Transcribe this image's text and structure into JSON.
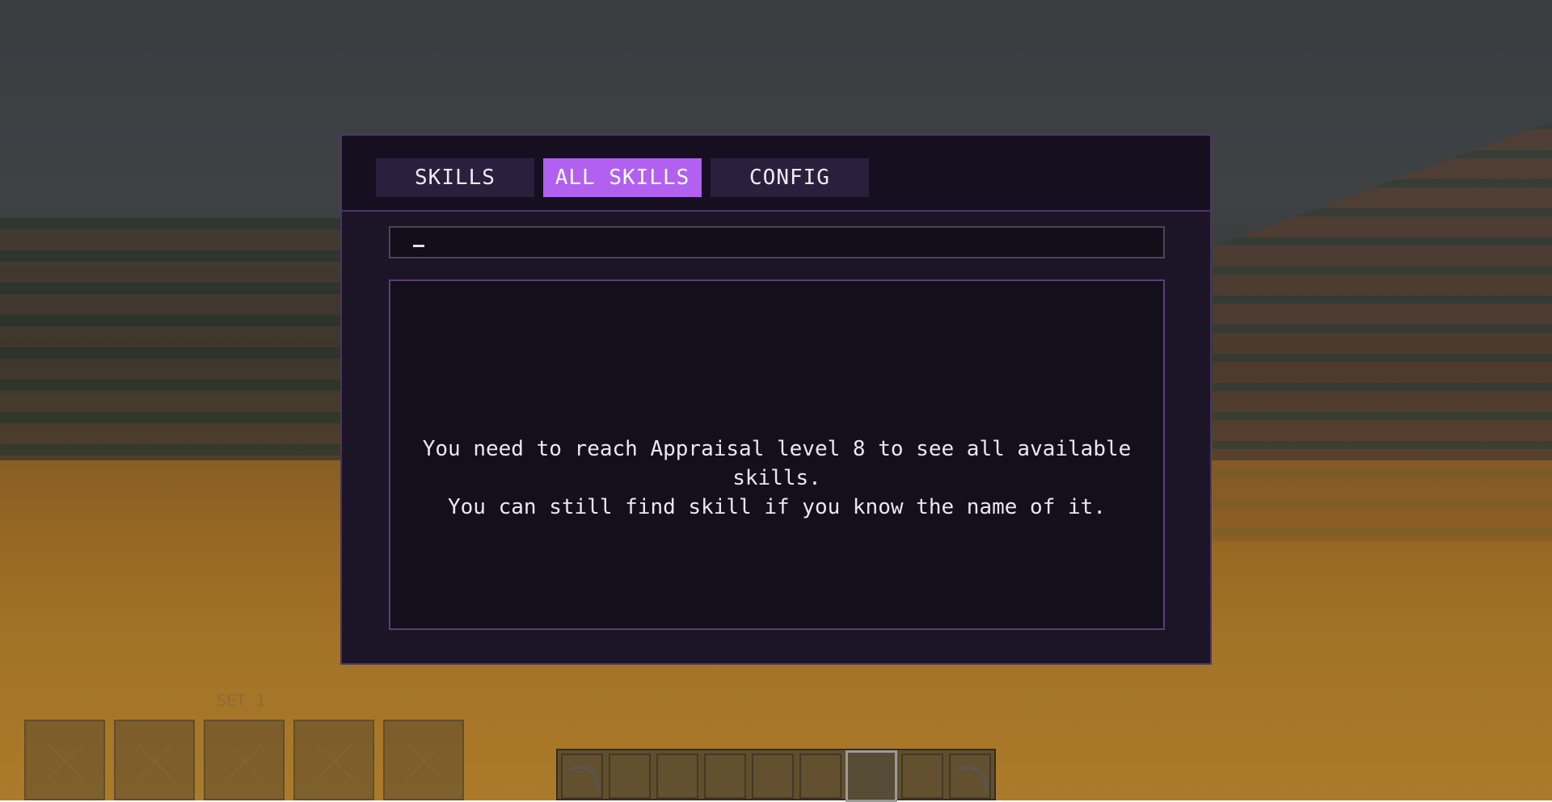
{
  "tabs": [
    {
      "label": "SKILLS",
      "active": false
    },
    {
      "label": "ALL SKILLS",
      "active": true
    },
    {
      "label": "CONFIG",
      "active": false
    }
  ],
  "search": {
    "value": "",
    "cursor": "_"
  },
  "content": {
    "message_line1": "You need to reach Appraisal level 8 to see all available skills.",
    "message_line2": "You can still find skill if you know the name of it."
  },
  "hud": {
    "set_label": "SET 1",
    "hotbar_selected_slot": 7,
    "hotbar_slots": 9
  },
  "colors": {
    "accent": "#b160f0",
    "dialog_bg": "#1c1528",
    "dialog_border": "#4a3560"
  }
}
